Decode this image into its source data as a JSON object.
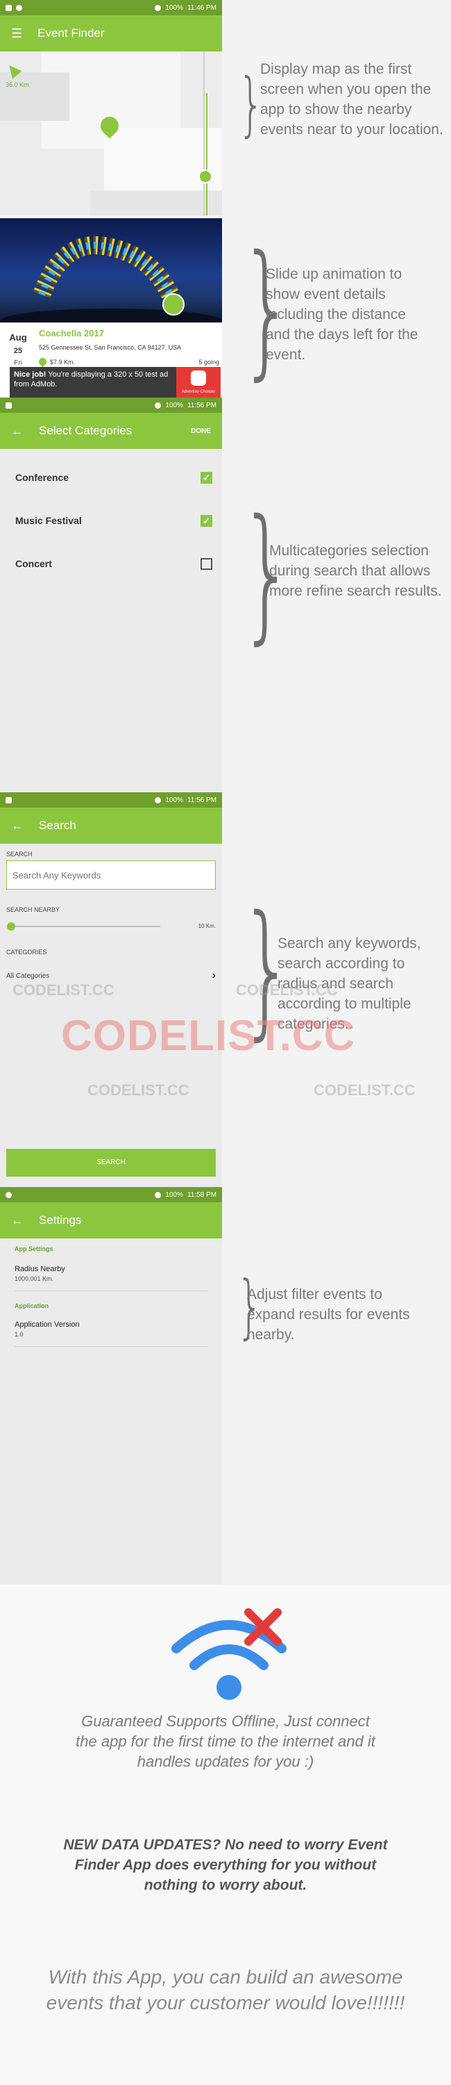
{
  "status": {
    "s1": {
      "battery": "100%",
      "time": "11:46 PM"
    },
    "s2": {
      "battery": "100%",
      "time": "11:56 PM"
    },
    "s3": {
      "battery": "100%",
      "time": "11:56 PM"
    },
    "s4": {
      "battery": "100%",
      "time": "11:58 PM"
    }
  },
  "map_screen": {
    "title": "Event Finder",
    "distance_badge": "36.0 Km."
  },
  "event_card": {
    "month": "Aug",
    "day": "25",
    "weekday": "Fri",
    "name": "Coachella 2017",
    "address": "525 Gennessee St, San Francisco, CA 94127, USA",
    "distance": "$7.9 Km.",
    "going": "5 going"
  },
  "ad": {
    "bold": "Nice job!",
    "text": " You're displaying a 320 x 50 test ad from AdMob.",
    "brand": "Advertise Choices"
  },
  "categories_screen": {
    "title": "Select Categories",
    "done": "DONE",
    "items": [
      {
        "label": "Conference",
        "checked": true
      },
      {
        "label": "Music Festival",
        "checked": true
      },
      {
        "label": "Concert",
        "checked": false
      }
    ]
  },
  "search_screen": {
    "title": "Search",
    "search_label": "SEARCH",
    "placeholder": "Search Any Keywords",
    "nearby_label": "SEARCH NEARBY",
    "radius_value": "10 Km.",
    "categories_label": "CATEGORIES",
    "categories_value": "All Categories",
    "search_button": "SEARCH"
  },
  "settings_screen": {
    "title": "Settings",
    "section_app": "App Settings",
    "radius_label": "Radius Nearby",
    "radius_value": "1000.001 Km.",
    "section_application": "Application",
    "version_label": "Application Version",
    "version_value": "1.0"
  },
  "captions": {
    "c1": "Display map as the first screen when you open the app to show the nearby events near to your location.",
    "c2": "Slide up animation to show event details including the distance and the days left for the event.",
    "c3": "Multicategories selection during search that allows more refine search results.",
    "c4": "Search any keywords, search according to radius and search according to multiple categories..",
    "c5": "Adjust filter events to expand results for events nearby."
  },
  "watermarks": {
    "small": "CODELIST.CC",
    "large": "CODELIST.CC"
  },
  "promo": {
    "offline": "Guaranteed Supports Offline, Just connect the app for the first time to the internet and it handles updates for you :)",
    "updates": "NEW DATA UPDATES? No need to worry Event Finder App does everything for you without nothing to worry about.",
    "closing": "With this App, you can build an awesome events that your customer would love!!!!!!!"
  },
  "colors": {
    "accent": "#8cc63f",
    "statusbar": "#6f9f2c",
    "wifi_blue": "#3d8ee8",
    "cross_red": "#e23b3b"
  }
}
